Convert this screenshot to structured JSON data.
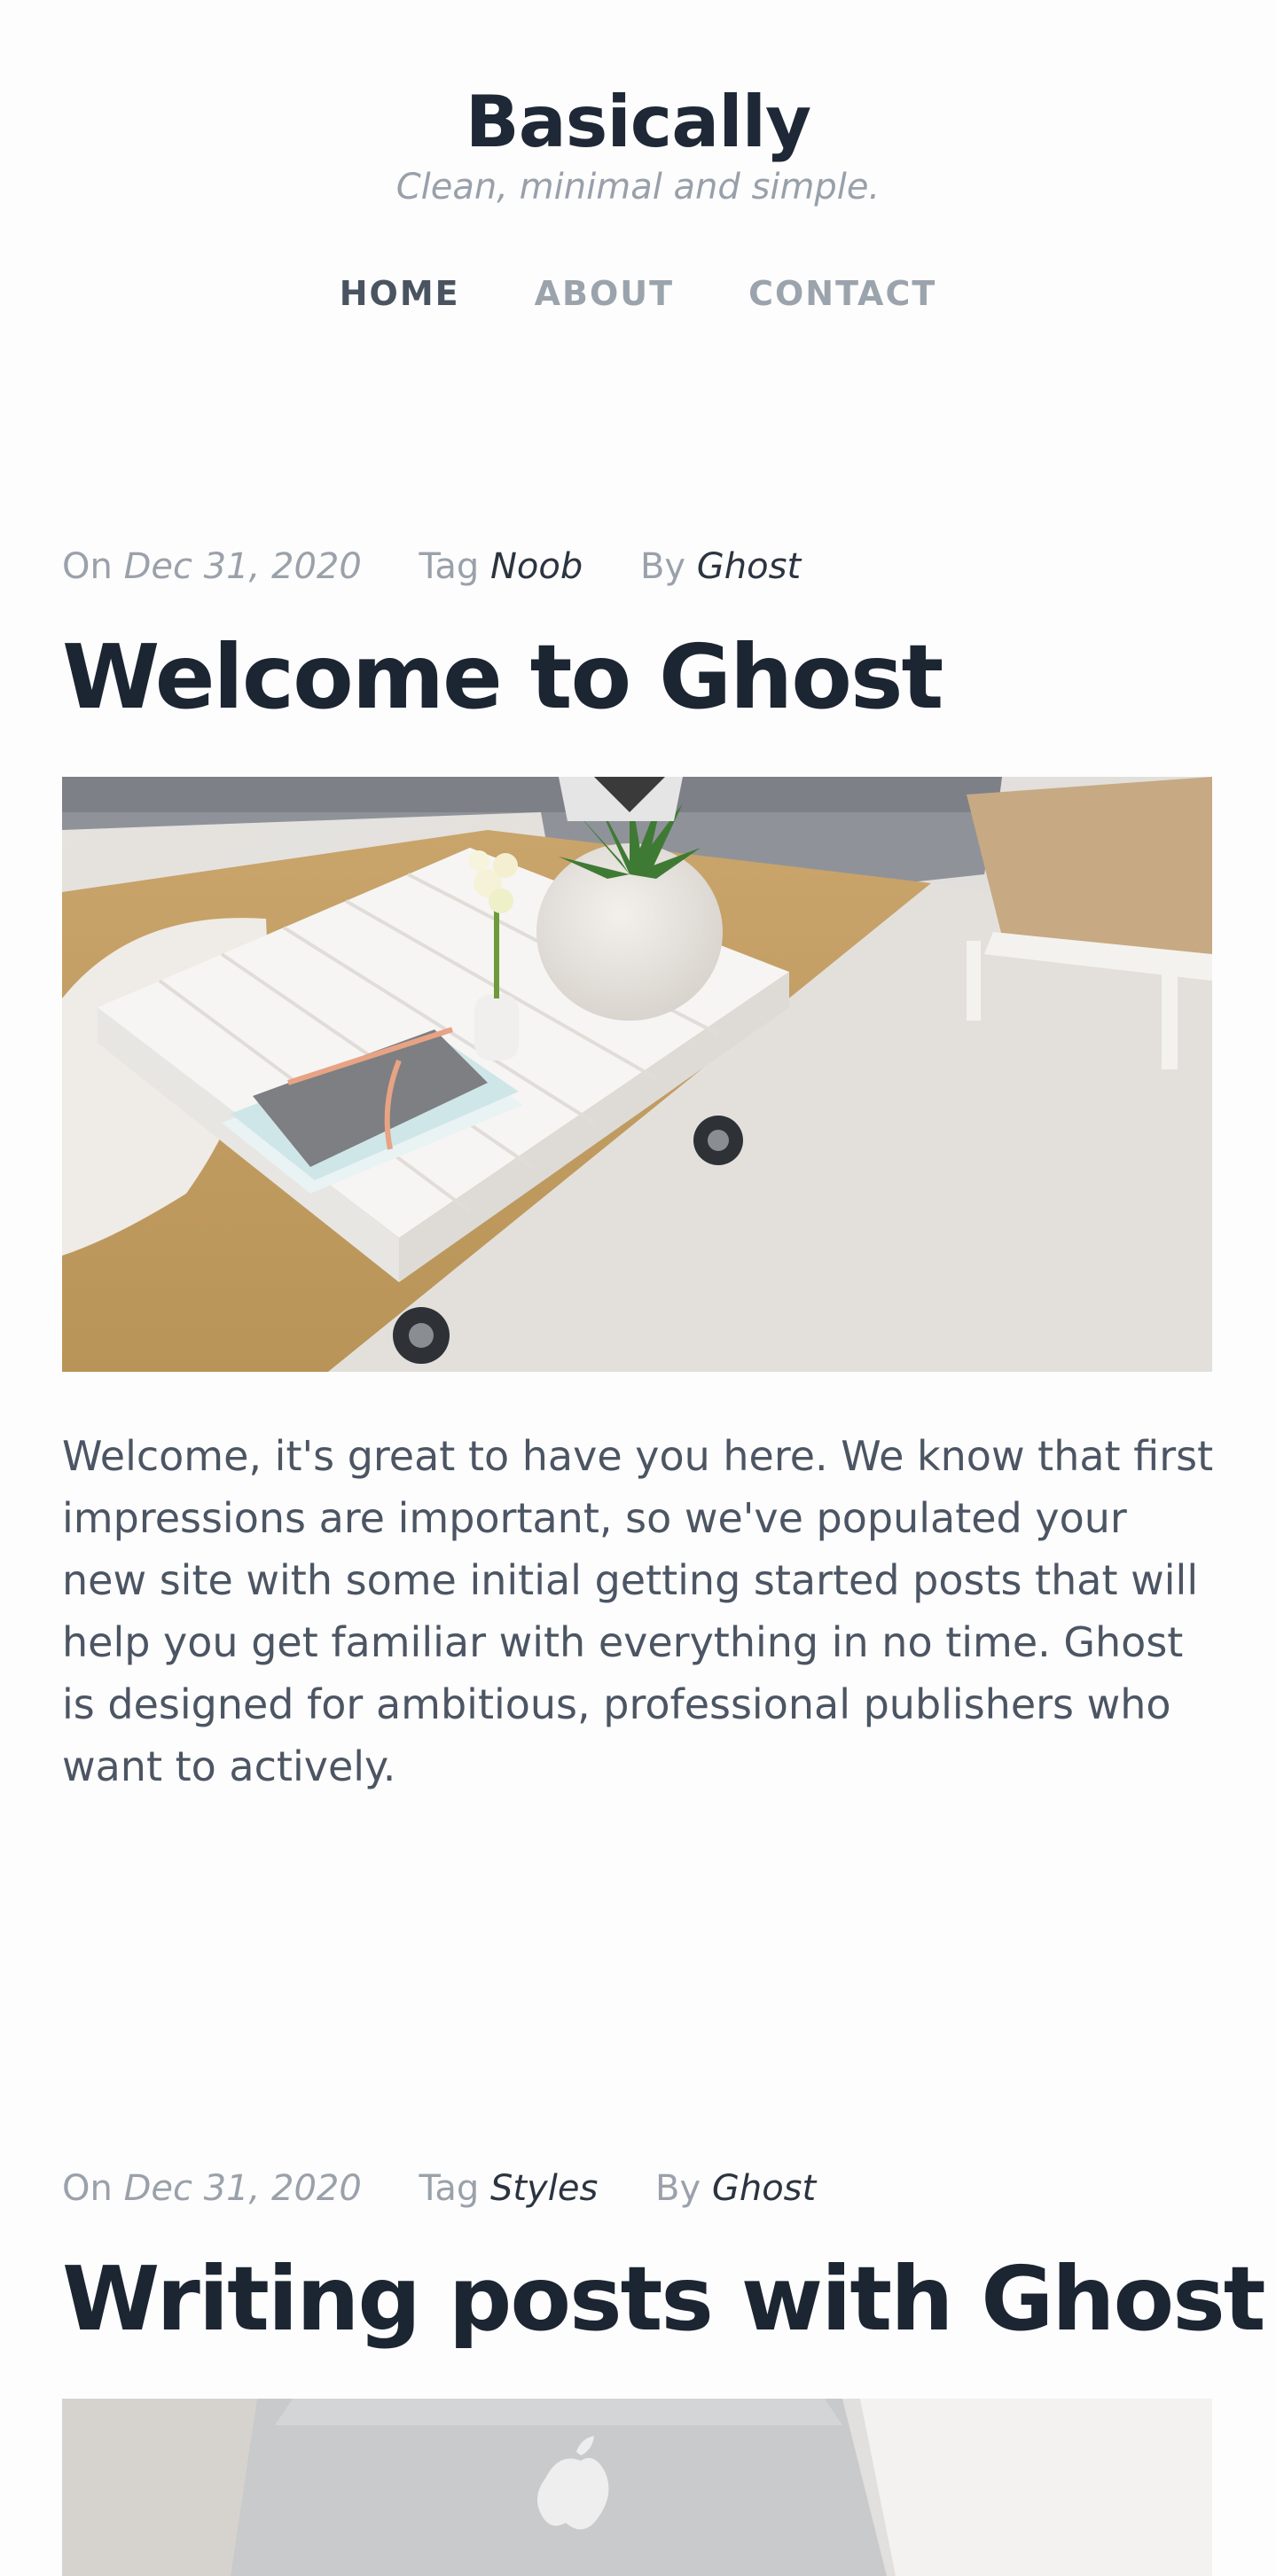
{
  "site": {
    "title": "Basically",
    "tagline": "Clean, minimal and simple."
  },
  "nav": {
    "items": [
      {
        "label": "HOME",
        "active": true
      },
      {
        "label": "ABOUT",
        "active": false
      },
      {
        "label": "CONTACT",
        "active": false
      }
    ]
  },
  "posts": [
    {
      "meta": {
        "on_label": "On",
        "date": "Dec 31, 2020",
        "tag_label": "Tag",
        "tag": "Noob",
        "by_label": "By",
        "author": "Ghost"
      },
      "title": "Welcome to Ghost",
      "image": "coffee-table-living-room-photo",
      "excerpt": "Welcome, it's great to have you here. We know that first impressions are important, so we've populated your new site with some initial getting started posts that will help you get familiar with everything in no time. Ghost is designed for ambitious, professional publishers who want to actively."
    },
    {
      "meta": {
        "on_label": "On",
        "date": "Dec 31, 2020",
        "tag_label": "Tag",
        "tag": "Styles",
        "by_label": "By",
        "author": "Ghost"
      },
      "title": "Writing posts with Ghost",
      "image": "laptop-on-bed-photo"
    }
  ]
}
